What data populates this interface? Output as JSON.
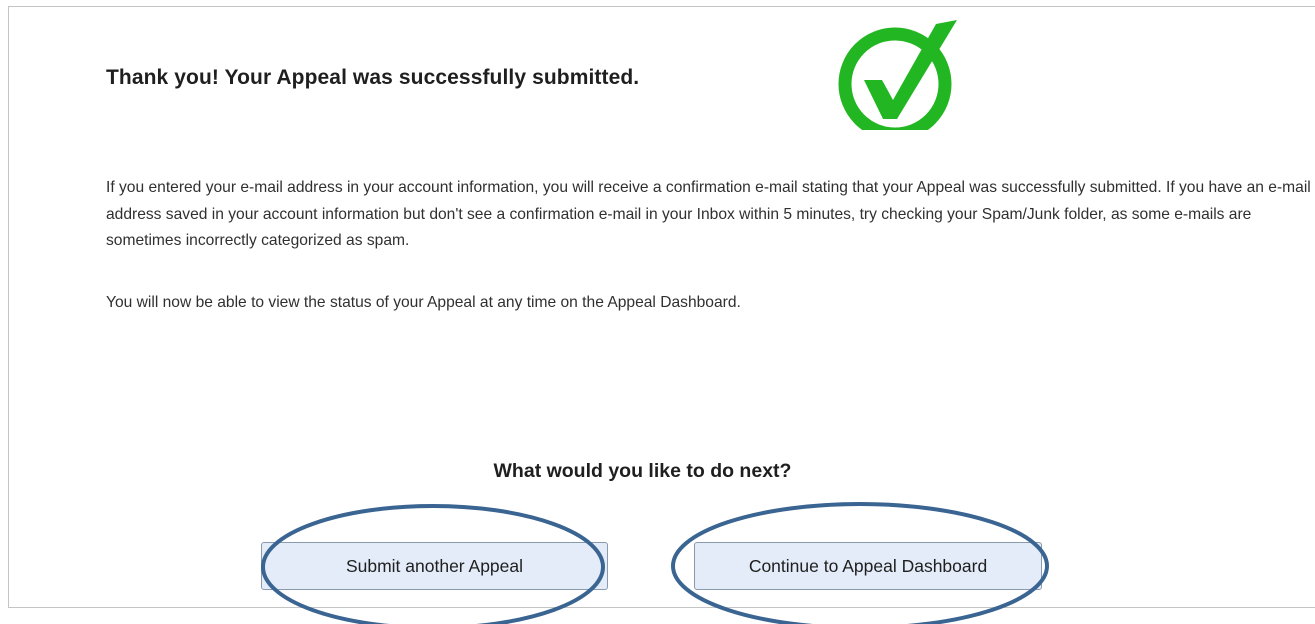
{
  "confirmation": {
    "title": "Thank you!  Your Appeal was successfully submitted.",
    "paragraph_1": "If you entered your e-mail address in your account information, you will receive a confirmation e-mail stating that your Appeal was successfully submitted. If you have an e-mail address saved in your account information but don't see a confirmation e-mail in your Inbox within 5 minutes, try checking your Spam/Junk folder, as some e-mails are sometimes incorrectly categorized as spam.",
    "paragraph_2": "You will now be able to view the status of your Appeal at any time on the Appeal Dashboard.",
    "check_icon": "checkmark-circle-icon",
    "check_color": "#22b722"
  },
  "next_steps": {
    "heading": "What would you like to do next?",
    "submit_another_label": "Submit another Appeal",
    "continue_dashboard_label": "Continue to Appeal Dashboard"
  },
  "annotations": {
    "highlight_color": "#3a6491"
  }
}
